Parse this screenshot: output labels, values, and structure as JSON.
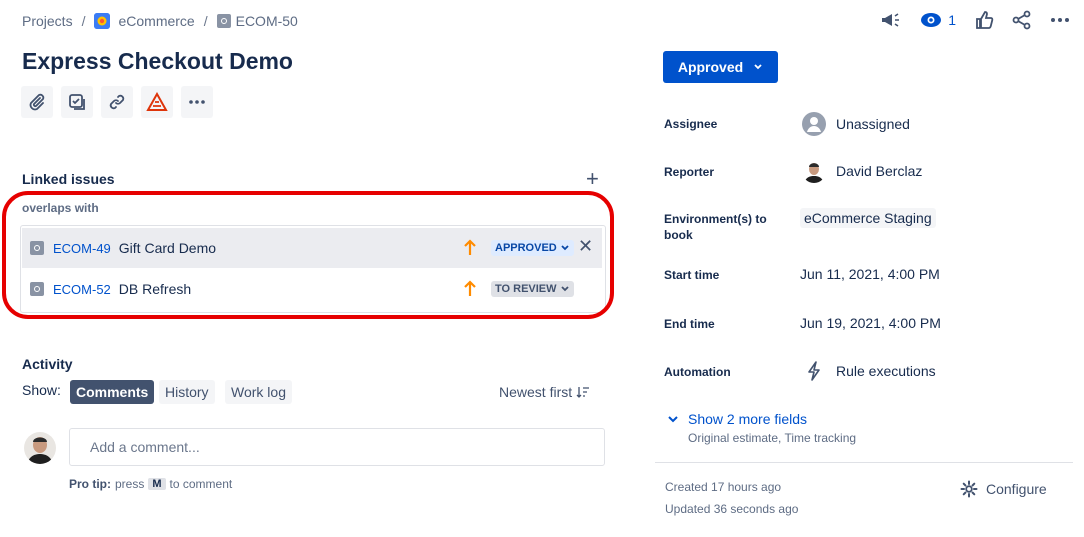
{
  "breadcrumb": {
    "projects": "Projects",
    "project": "eCommerce",
    "issue_key": "ECOM-50",
    "separator": "/"
  },
  "top_actions": {
    "watchers_count": "1"
  },
  "issue": {
    "title": "Express Checkout Demo"
  },
  "linked_issues": {
    "heading": "Linked issues",
    "relation": "overlaps with",
    "add_symbol": "+",
    "items": [
      {
        "key": "ECOM-49",
        "summary": "Gift Card Demo",
        "status": "APPROVED",
        "status_color": "#0747a6",
        "priority_color": "#ff8b00"
      },
      {
        "key": "ECOM-52",
        "summary": "DB Refresh",
        "status": "TO REVIEW",
        "status_color": "#42526e",
        "priority_color": "#ff8b00"
      }
    ],
    "remove_symbol": "✕"
  },
  "activity": {
    "heading": "Activity",
    "show_label": "Show:",
    "tabs": [
      "Comments",
      "History",
      "Work log"
    ],
    "sort_label": "Newest first",
    "comment_placeholder": "Add a comment...",
    "pro_tip_label": "Pro tip:",
    "pro_tip_press": "press",
    "pro_tip_key": "M",
    "pro_tip_rest": "to comment"
  },
  "sidebar": {
    "status_label": "Approved",
    "fields": [
      {
        "label": "Assignee",
        "value": "Unassigned"
      },
      {
        "label": "Reporter",
        "value": "David Berclaz"
      },
      {
        "label": "Environment(s) to book",
        "value": "eCommerce Staging"
      },
      {
        "label": "Start time",
        "value": "Jun 11, 2021, 4:00 PM"
      },
      {
        "label": "End time",
        "value": "Jun 19, 2021, 4:00 PM"
      },
      {
        "label": "Automation",
        "value": "Rule executions"
      }
    ],
    "show_more": "Show 2 more fields",
    "show_more_sub": "Original estimate, Time tracking",
    "created": "Created 17 hours ago",
    "updated": "Updated 36 seconds ago",
    "configure": "Configure"
  },
  "colors": {
    "primary": "#0052cc",
    "highlight_frame": "#e60000",
    "text": "#172b4d"
  }
}
